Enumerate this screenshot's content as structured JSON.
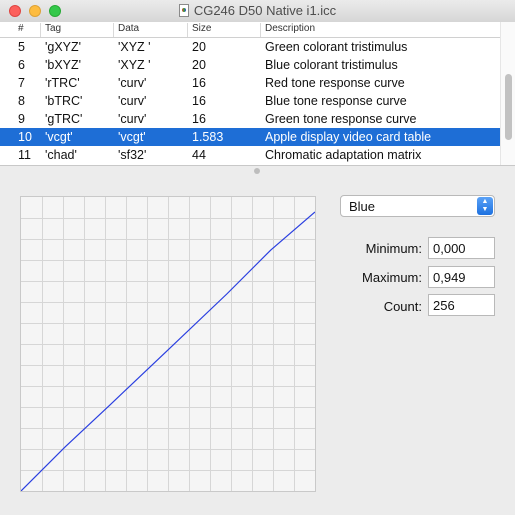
{
  "window": {
    "title": "CG246 D50 Native i1.icc"
  },
  "table": {
    "headers": {
      "num": "#",
      "tag": "Tag",
      "data": "Data",
      "size": "Size",
      "description": "Description"
    },
    "rows": [
      {
        "num": "5",
        "tag": "'gXYZ'",
        "data": "'XYZ '",
        "size": "20",
        "description": "Green colorant tristimulus"
      },
      {
        "num": "6",
        "tag": "'bXYZ'",
        "data": "'XYZ '",
        "size": "20",
        "description": "Blue colorant tristimulus"
      },
      {
        "num": "7",
        "tag": "'rTRC'",
        "data": "'curv'",
        "size": "16",
        "description": "Red tone response curve"
      },
      {
        "num": "8",
        "tag": "'bTRC'",
        "data": "'curv'",
        "size": "16",
        "description": "Blue tone response curve"
      },
      {
        "num": "9",
        "tag": "'gTRC'",
        "data": "'curv'",
        "size": "16",
        "description": "Green tone response curve"
      },
      {
        "num": "10",
        "tag": "'vcgt'",
        "data": "'vcgt'",
        "size": "1.583",
        "description": "Apple display video card table",
        "selected": true
      },
      {
        "num": "11",
        "tag": "'chad'",
        "data": "'sf32'",
        "size": "44",
        "description": "Chromatic adaptation matrix"
      }
    ]
  },
  "channel_select": {
    "value": "Blue"
  },
  "fields": {
    "minimum": {
      "label": "Minimum:",
      "value": "0,000"
    },
    "maximum": {
      "label": "Maximum:",
      "value": "0,949"
    },
    "count": {
      "label": "Count:",
      "value": "256"
    }
  },
  "curve": {
    "color": "#2a3fe0",
    "grid_divisions": 14,
    "points": [
      [
        0,
        0
      ],
      [
        0.15,
        0.15
      ],
      [
        0.3,
        0.29
      ],
      [
        0.5,
        0.48
      ],
      [
        0.7,
        0.67
      ],
      [
        0.85,
        0.82
      ],
      [
        1.0,
        0.949
      ]
    ]
  }
}
